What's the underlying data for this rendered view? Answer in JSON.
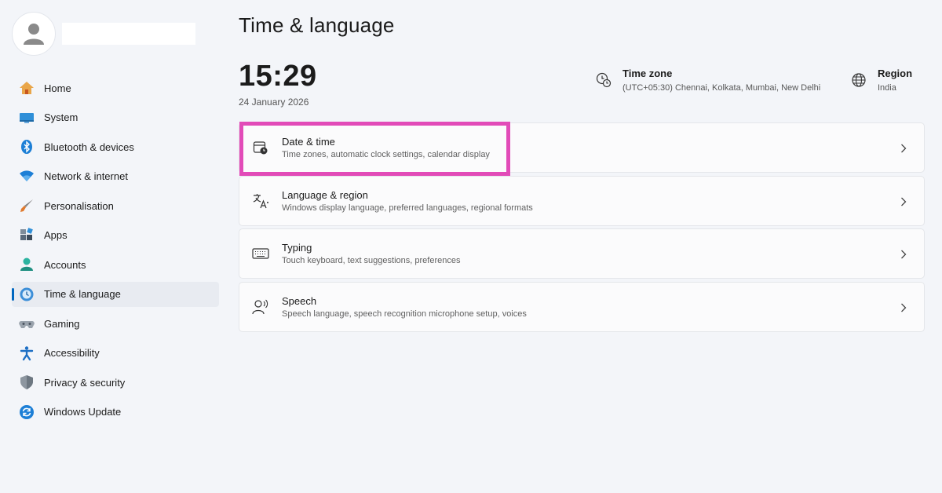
{
  "sidebar": {
    "items": [
      {
        "label": "Home",
        "icon": "home-icon"
      },
      {
        "label": "System",
        "icon": "system-icon"
      },
      {
        "label": "Bluetooth & devices",
        "icon": "bluetooth-icon"
      },
      {
        "label": "Network & internet",
        "icon": "wifi-icon"
      },
      {
        "label": "Personalisation",
        "icon": "brush-icon"
      },
      {
        "label": "Apps",
        "icon": "apps-icon"
      },
      {
        "label": "Accounts",
        "icon": "accounts-icon"
      },
      {
        "label": "Time & language",
        "icon": "time-language-icon",
        "active": true
      },
      {
        "label": "Gaming",
        "icon": "gaming-icon"
      },
      {
        "label": "Accessibility",
        "icon": "accessibility-icon"
      },
      {
        "label": "Privacy & security",
        "icon": "shield-icon"
      },
      {
        "label": "Windows Update",
        "icon": "update-icon"
      }
    ]
  },
  "main": {
    "title": "Time & language",
    "clock": "15:29",
    "date": "24 January 2026",
    "timezone": {
      "title": "Time zone",
      "value": "(UTC+05:30) Chennai, Kolkata, Mumbai, New Delhi"
    },
    "region": {
      "title": "Region",
      "value": "India"
    },
    "cards": [
      {
        "title": "Date & time",
        "desc": "Time zones, automatic clock settings, calendar display",
        "icon": "calendar-clock-icon",
        "highlighted": true
      },
      {
        "title": "Language & region",
        "desc": "Windows display language, preferred languages, regional formats",
        "icon": "language-icon"
      },
      {
        "title": "Typing",
        "desc": "Touch keyboard, text suggestions, preferences",
        "icon": "keyboard-icon"
      },
      {
        "title": "Speech",
        "desc": "Speech language, speech recognition microphone setup, voices",
        "icon": "speech-icon"
      }
    ]
  },
  "colors": {
    "accent": "#0067c0",
    "highlight_border": "#e24bb8",
    "background": "#f3f5f9"
  }
}
